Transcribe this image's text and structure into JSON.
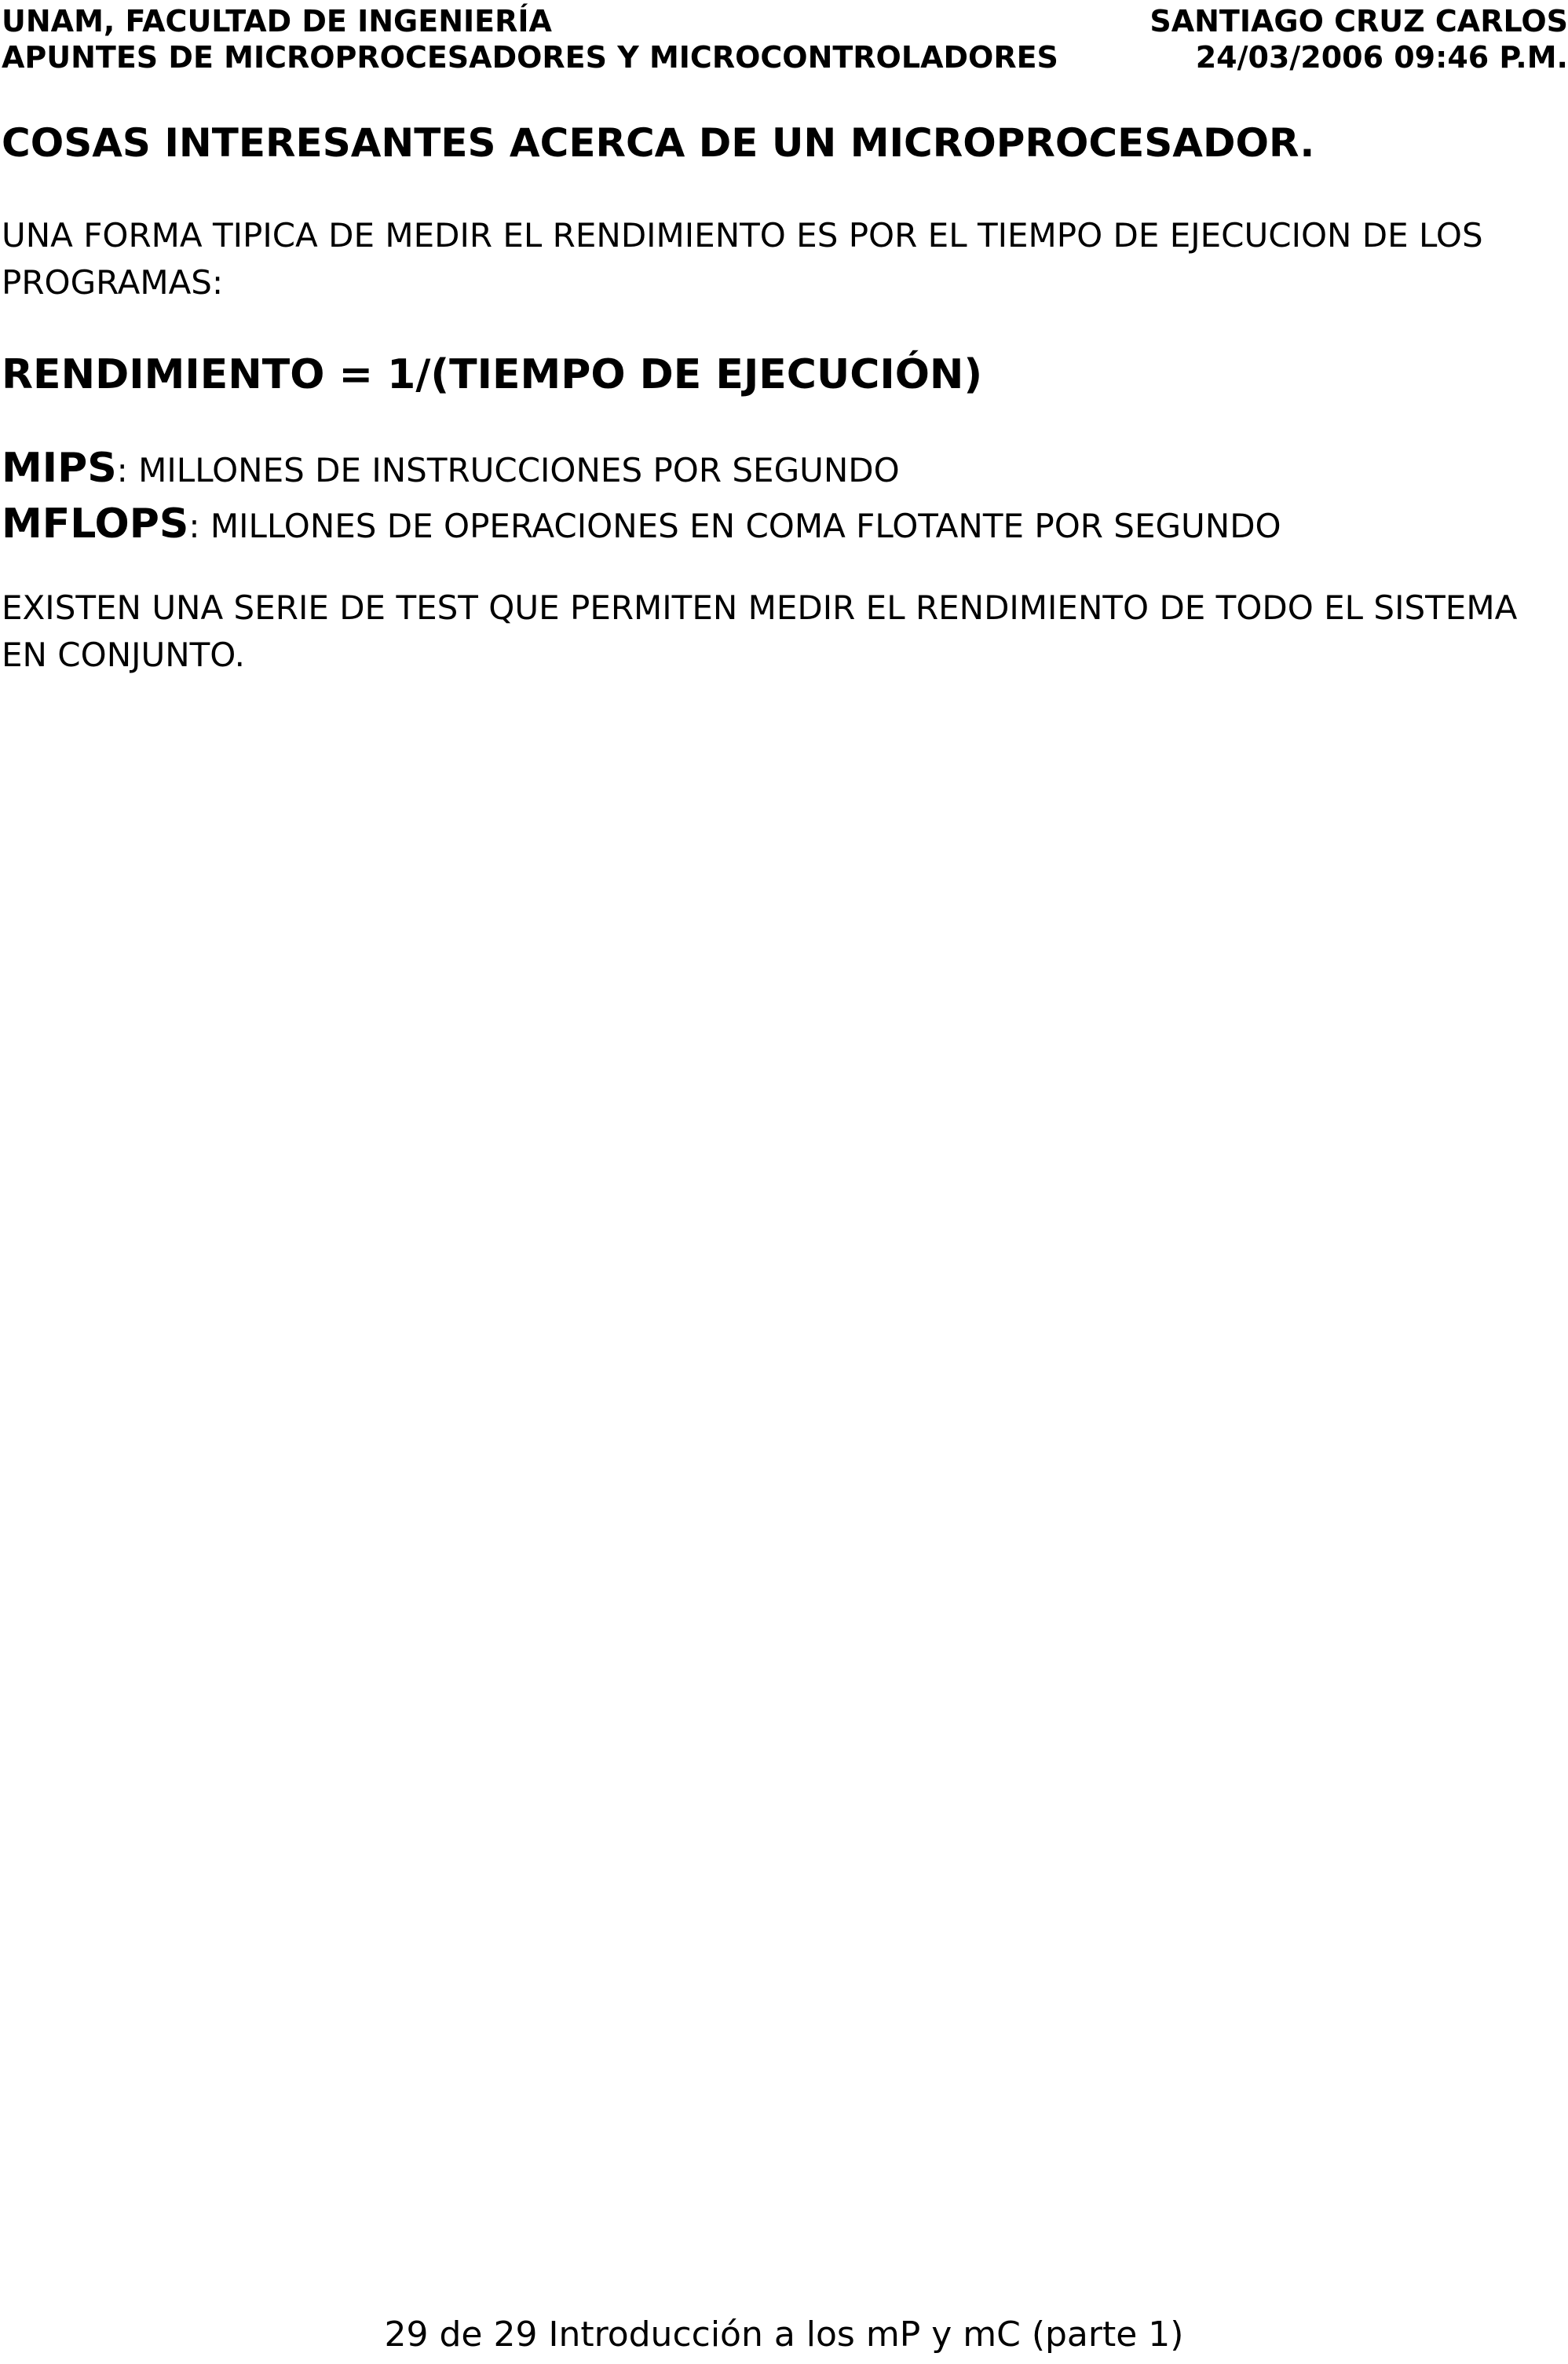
{
  "header": {
    "left_line1": "UNAM, FACULTAD DE INGENIERÍA",
    "left_line2": "APUNTES DE MICROPROCESADORES Y MICROCONTROLADORES",
    "right_line1": "SANTIAGO CRUZ CARLOS",
    "right_line2": "24/03/2006 09:46 P.M."
  },
  "main": {
    "title": "COSAS INTERESANTES ACERCA DE UN MICROPROCESADOR.",
    "paragraph1": "UNA FORMA TIPICA DE MEDIR EL RENDIMIENTO ES POR EL TIEMPO DE EJECUCION DE LOS PROGRAMAS:",
    "formula": "RENDIMIENTO = 1/(TIEMPO DE EJECUCIÓN)",
    "definitions": [
      {
        "term": "MIPS",
        "separator": ": ",
        "description": "MILLONES DE INSTRUCCIONES POR SEGUNDO"
      },
      {
        "term": "MFLOPS",
        "separator": ": ",
        "description": "MILLONES DE OPERACIONES EN COMA FLOTANTE POR SEGUNDO"
      }
    ],
    "paragraph2": "EXISTEN UNA SERIE DE TEST QUE PERMITEN MEDIR EL RENDIMIENTO DE TODO EL SISTEMA EN CONJUNTO."
  },
  "footer": {
    "text": "29 de 29 Introducción a los mP y mC (parte 1)"
  }
}
